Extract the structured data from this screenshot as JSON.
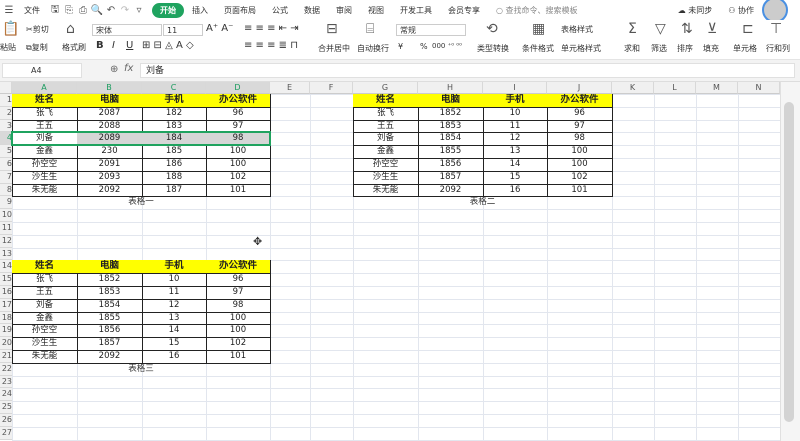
{
  "menubar": {
    "file": "文件",
    "tabs": [
      "开始",
      "插入",
      "页面布局",
      "公式",
      "数据",
      "审阅",
      "视图",
      "开发工具",
      "会员专享"
    ],
    "active_tab": "开始",
    "search_placeholder": "查找命令、搜索模板",
    "sync": "未同步",
    "collab": "协作"
  },
  "ribbon": {
    "paste": "粘贴",
    "cut": "剪切",
    "copy": "复制",
    "format_painter": "格式刷",
    "font": "宋体",
    "font_size": "11",
    "merge": "合并居中",
    "wrap": "自动换行",
    "number_format": "常规",
    "currency": "¥",
    "percent": "%",
    "type_convert": "类型转换",
    "cond_format": "条件格式",
    "table_style": "表格样式",
    "cell_style": "单元格样式",
    "sum": "求和",
    "filter": "筛选",
    "sort": "排序",
    "fill": "填充",
    "cell": "单元格",
    "rowcol": "行和列",
    "bold": "B",
    "italic": "I",
    "underline": "U"
  },
  "formula": {
    "cell_ref": "A4",
    "fx": "fx",
    "value": "刘备"
  },
  "columns": [
    "A",
    "B",
    "C",
    "D",
    "E",
    "F",
    "G",
    "H",
    "I",
    "J",
    "K",
    "L",
    "M",
    "N"
  ],
  "tables": [
    {
      "caption": "表格一",
      "headers": [
        "姓名",
        "电脑",
        "手机",
        "办公软件"
      ],
      "rows": [
        [
          "张飞",
          "2087",
          "182",
          "96"
        ],
        [
          "王五",
          "2088",
          "183",
          "97"
        ],
        [
          "刘备",
          "2089",
          "184",
          "98"
        ],
        [
          "金鑫",
          "230",
          "185",
          "100"
        ],
        [
          "孙空空",
          "2091",
          "186",
          "100"
        ],
        [
          "沙生生",
          "2093",
          "188",
          "102"
        ],
        [
          "朱无能",
          "2092",
          "187",
          "101"
        ]
      ]
    },
    {
      "caption": "表格二",
      "headers": [
        "姓名",
        "电脑",
        "手机",
        "办公软件"
      ],
      "rows": [
        [
          "张飞",
          "1852",
          "10",
          "96"
        ],
        [
          "王五",
          "1853",
          "11",
          "97"
        ],
        [
          "刘备",
          "1854",
          "12",
          "98"
        ],
        [
          "金鑫",
          "1855",
          "13",
          "100"
        ],
        [
          "孙空空",
          "1856",
          "14",
          "100"
        ],
        [
          "沙生生",
          "1857",
          "15",
          "102"
        ],
        [
          "朱无能",
          "2092",
          "16",
          "101"
        ]
      ]
    },
    {
      "caption": "表格三",
      "headers": [
        "姓名",
        "电脑",
        "手机",
        "办公软件"
      ],
      "rows": [
        [
          "张飞",
          "1852",
          "10",
          "96"
        ],
        [
          "王五",
          "1853",
          "11",
          "97"
        ],
        [
          "刘备",
          "1854",
          "12",
          "98"
        ],
        [
          "金鑫",
          "1855",
          "13",
          "100"
        ],
        [
          "孙空空",
          "1856",
          "14",
          "100"
        ],
        [
          "沙生生",
          "1857",
          "15",
          "102"
        ],
        [
          "朱无能",
          "2092",
          "16",
          "101"
        ]
      ]
    }
  ],
  "colors": {
    "accent": "#1fa35f",
    "header_fill": "#ffff00"
  }
}
